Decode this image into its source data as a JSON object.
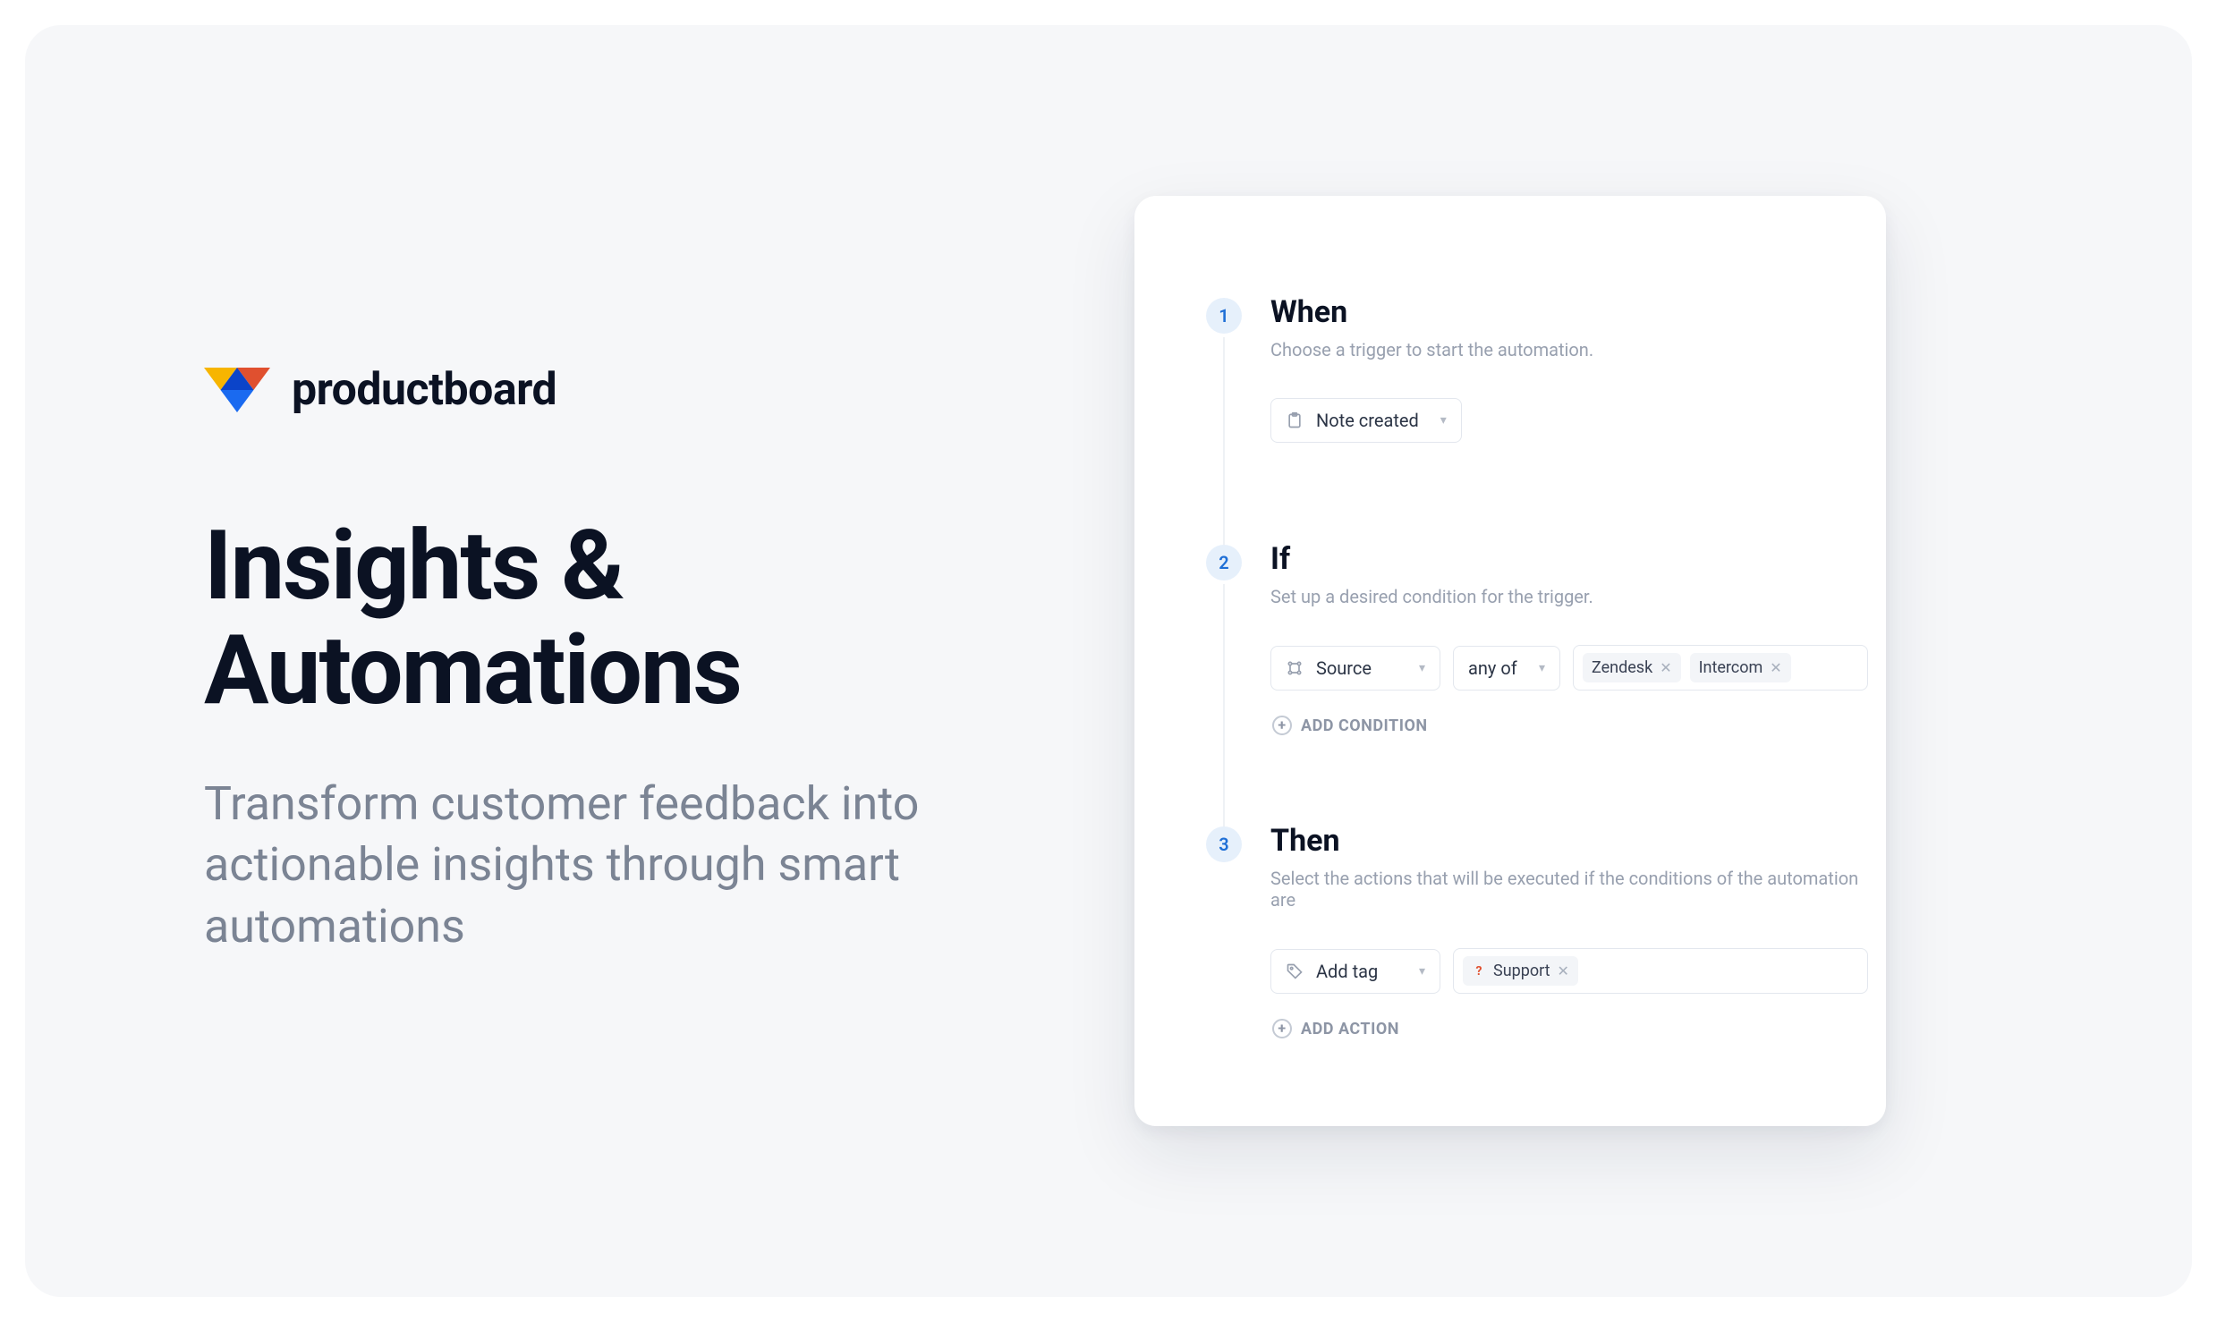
{
  "brand": {
    "name": "productboard"
  },
  "hero": {
    "headline": "Insights & Automations",
    "subhead": "Transform customer feedback into actionable insights through smart automations"
  },
  "automation": {
    "steps": [
      {
        "number": "1",
        "title": "When",
        "description": "Choose a trigger to start the automation.",
        "trigger_label": "Note created"
      },
      {
        "number": "2",
        "title": "If",
        "description": "Set up a desired condition for the trigger.",
        "field_label": "Source",
        "operator_label": "any of",
        "chips": [
          "Zendesk",
          "Intercom"
        ],
        "add_button": "Add Condition"
      },
      {
        "number": "3",
        "title": "Then",
        "description": "Select the actions that will be executed if the conditions of the automation are",
        "action_label": "Add tag",
        "chips": [
          "Support"
        ],
        "add_button": "Add Action"
      }
    ]
  }
}
